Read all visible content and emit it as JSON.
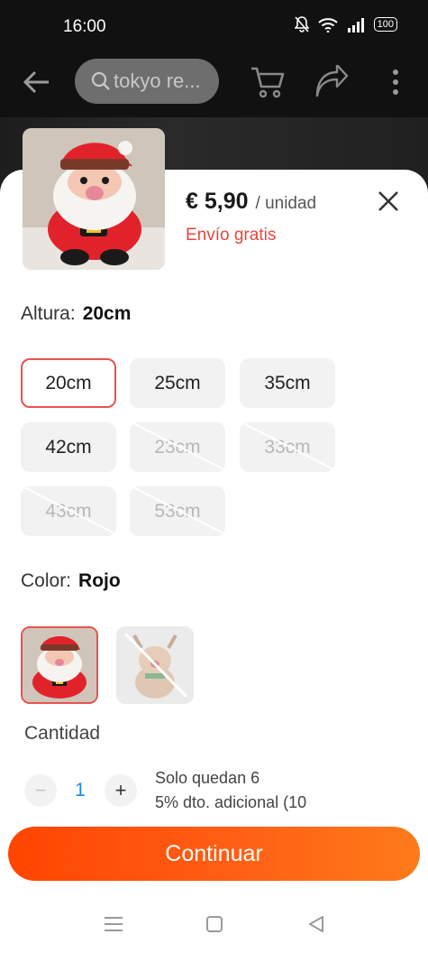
{
  "status_bar": {
    "time": "16:00",
    "battery": "100"
  },
  "app_bar": {
    "search_placeholder": "tokyo re..."
  },
  "product": {
    "price": "€ 5,90",
    "unit": "/ unidad",
    "shipping": "Envío gratis"
  },
  "size": {
    "label": "Altura:",
    "selected": "20cm",
    "options": [
      {
        "label": "20cm",
        "state": "selected"
      },
      {
        "label": "25cm",
        "state": "available"
      },
      {
        "label": "35cm",
        "state": "available"
      },
      {
        "label": "42cm",
        "state": "available"
      },
      {
        "label": "23cm",
        "state": "unavailable"
      },
      {
        "label": "33cm",
        "state": "unavailable"
      },
      {
        "label": "43cm",
        "state": "unavailable"
      },
      {
        "label": "53cm",
        "state": "unavailable"
      }
    ]
  },
  "color": {
    "label": "Color:",
    "selected": "Rojo",
    "options": [
      {
        "name": "santa-red",
        "state": "selected"
      },
      {
        "name": "reindeer-brown",
        "state": "unavailable"
      }
    ]
  },
  "quantity": {
    "label": "Cantidad",
    "value": "1",
    "decrement": "−",
    "increment": "+",
    "stock_note": "Solo quedan 6",
    "discount_note": "5% dto. adicional (10"
  },
  "actions": {
    "continue_label": "Continuar"
  },
  "colors": {
    "accent": "#e8534e",
    "cta_start": "#ff4500",
    "cta_end": "#ff7a1a",
    "shipping_text": "#e8453c",
    "qty_text": "#1a8bd6"
  }
}
